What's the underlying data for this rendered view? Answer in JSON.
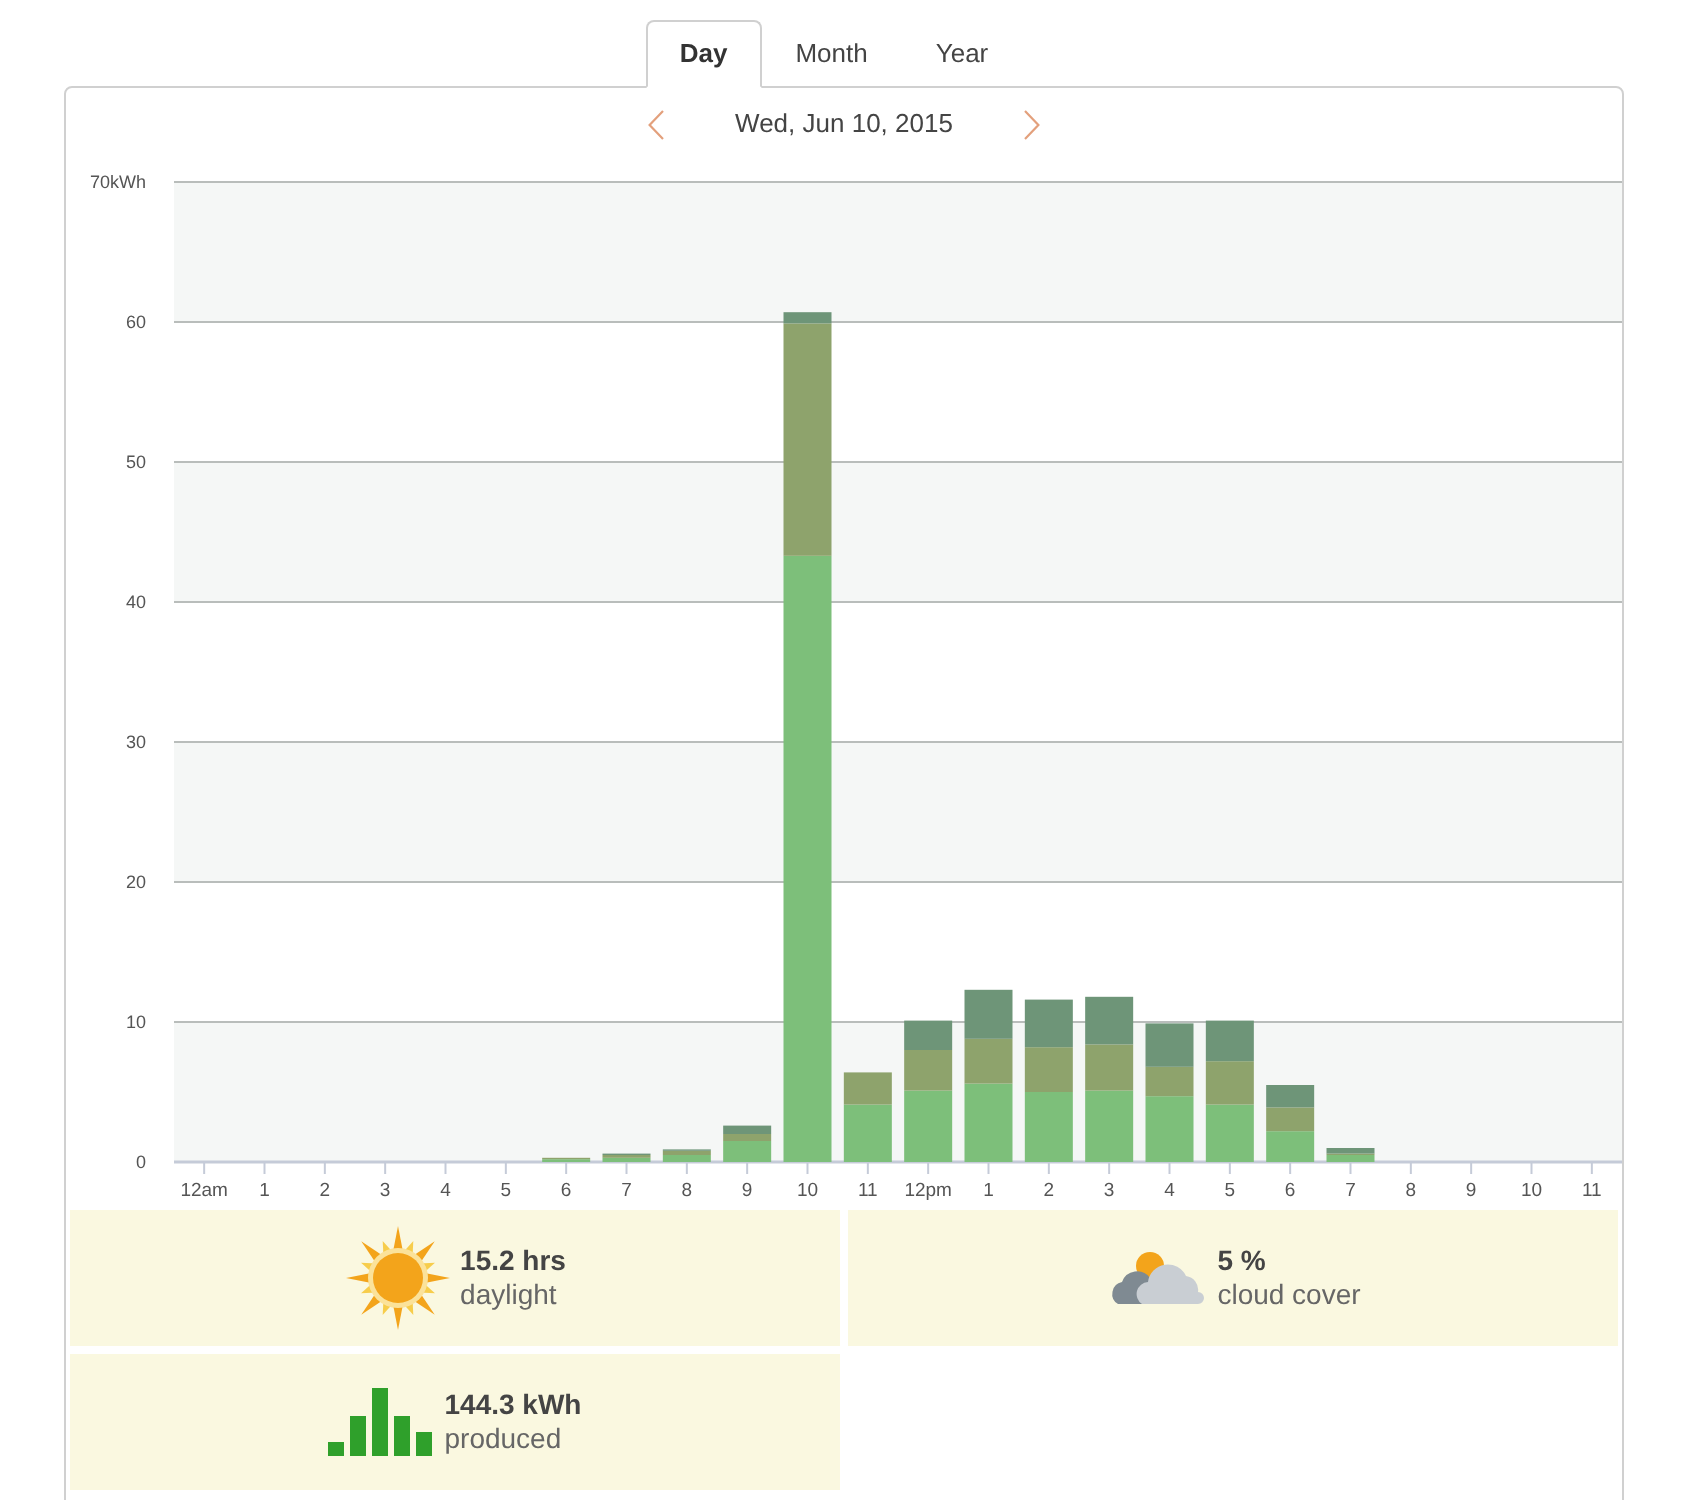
{
  "tabs": [
    {
      "label": "Day",
      "selected": true
    },
    {
      "label": "Month",
      "selected": false
    },
    {
      "label": "Year",
      "selected": false
    }
  ],
  "date_nav": {
    "date": "Wed, Jun 10, 2015"
  },
  "chart_data": {
    "type": "bar",
    "stacked": true,
    "grid": true,
    "categories": [
      "12am",
      "1",
      "2",
      "3",
      "4",
      "5",
      "6",
      "7",
      "8",
      "9",
      "10",
      "11",
      "12pm",
      "1",
      "2",
      "3",
      "4",
      "5",
      "6",
      "7",
      "8",
      "9",
      "10",
      "11"
    ],
    "ylim": [
      0,
      70
    ],
    "yticks": [
      0,
      10,
      20,
      30,
      40,
      50,
      60,
      {
        "value": 70,
        "label": "70kWh"
      }
    ],
    "series": [
      {
        "color": "#7dbf7a",
        "values": [
          0,
          0,
          0,
          0,
          0,
          0,
          0.2,
          0.3,
          0.5,
          1.5,
          43.3,
          4.1,
          5.1,
          5.6,
          5.0,
          5.1,
          4.7,
          4.1,
          2.2,
          0.5,
          0,
          0,
          0,
          0
        ]
      },
      {
        "color": "#8ea36c",
        "values": [
          0,
          0,
          0,
          0,
          0,
          0,
          0.1,
          0.2,
          0.3,
          0.5,
          16.6,
          2.3,
          2.9,
          3.2,
          3.2,
          3.3,
          2.1,
          3.1,
          1.7,
          0.1,
          0,
          0,
          0,
          0
        ]
      },
      {
        "color": "#6e9578",
        "values": [
          0,
          0,
          0,
          0,
          0,
          0,
          0,
          0.1,
          0.1,
          0.6,
          0.8,
          0,
          2.1,
          3.5,
          3.4,
          3.4,
          3.1,
          2.9,
          1.6,
          0.4,
          0,
          0,
          0,
          0
        ]
      }
    ]
  },
  "stats": [
    {
      "kind": "daylight",
      "value": "15.2 hrs",
      "label": "daylight"
    },
    {
      "kind": "cloud",
      "value": "5 %",
      "label": "cloud cover"
    },
    {
      "kind": "production",
      "value": "144.3 kWh",
      "label": "produced"
    }
  ]
}
